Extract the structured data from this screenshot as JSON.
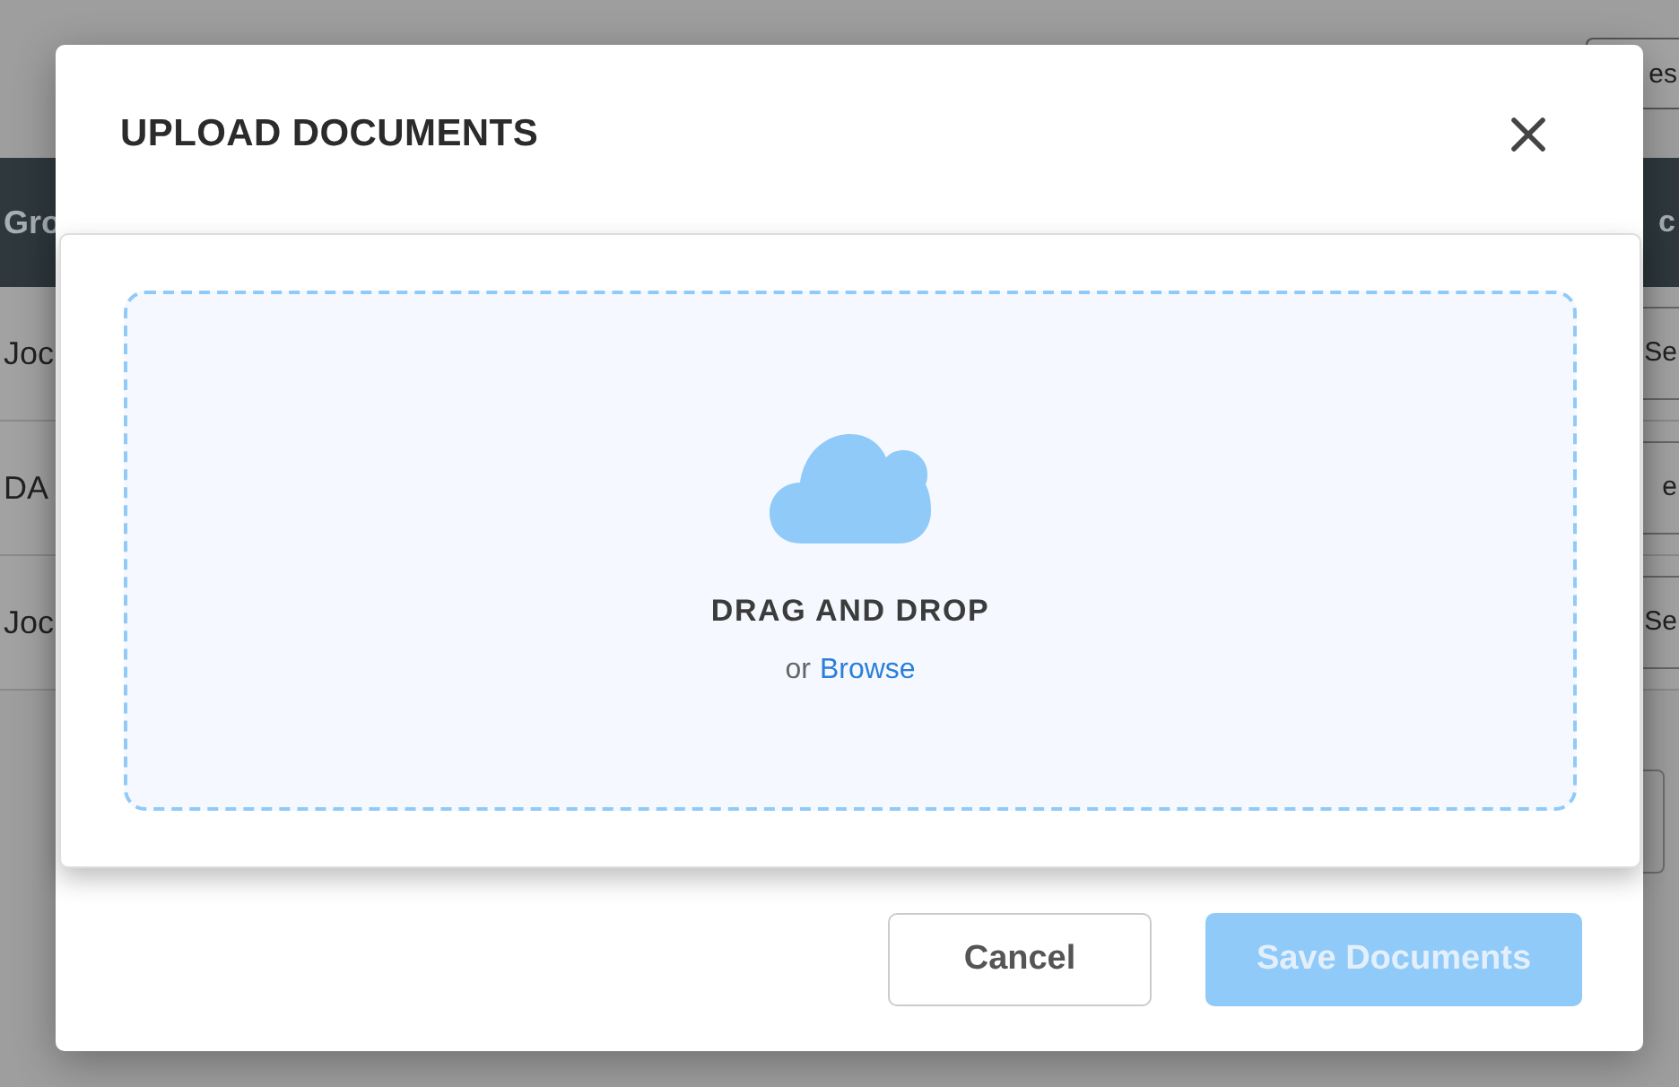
{
  "background": {
    "toolbar_button": "es",
    "table": {
      "columns": [
        "Gro",
        "c"
      ],
      "rows": [
        [
          "Joc",
          "Se"
        ],
        [
          "DA",
          "e"
        ],
        [
          "Joc",
          "Se"
        ]
      ]
    }
  },
  "dialog": {
    "title": "UPLOAD DOCUMENTS",
    "dropzone": {
      "heading": "DRAG AND DROP",
      "prefix": "or",
      "link": "Browse"
    },
    "buttons": [
      {
        "label": "Cancel",
        "kind": "secondary",
        "disabled": false
      },
      {
        "label": "Save Documents",
        "kind": "primary",
        "disabled": true
      }
    ]
  }
}
